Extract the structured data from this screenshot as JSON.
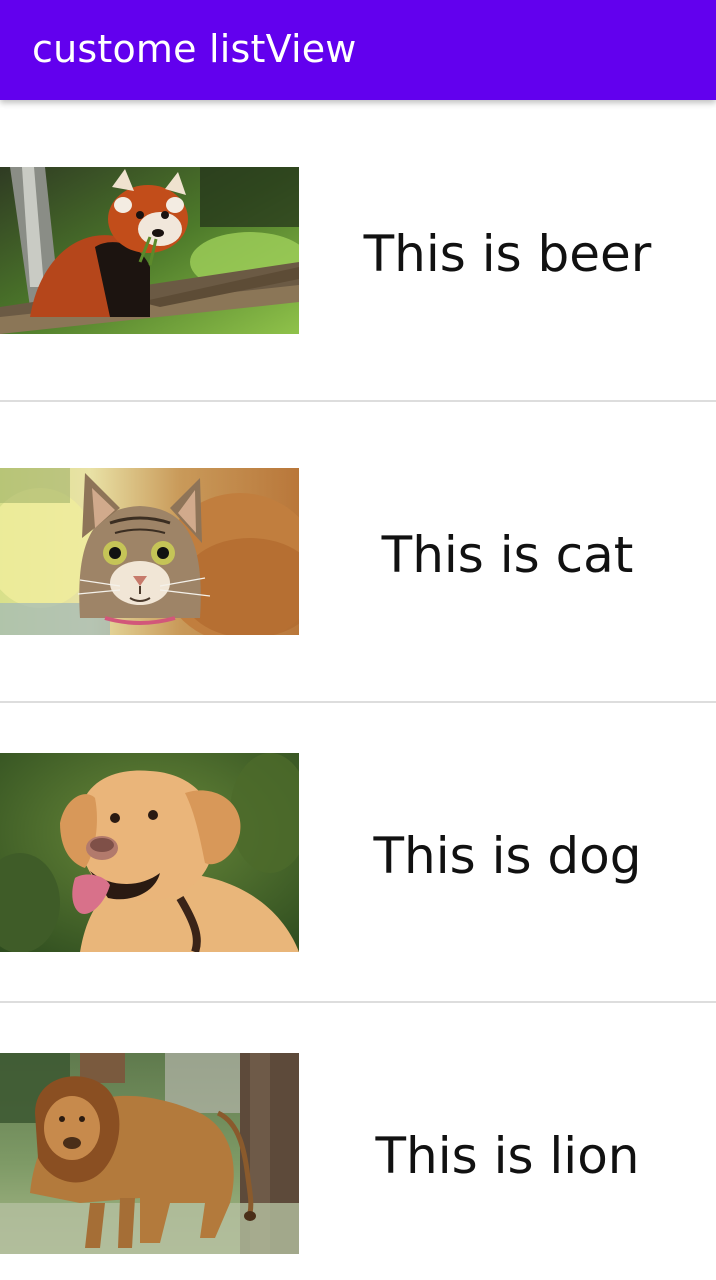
{
  "app_bar": {
    "title": "custome listView",
    "color": "#6200ee"
  },
  "list": {
    "items": [
      {
        "label": "This is beer",
        "image": "red-panda-photo"
      },
      {
        "label": "This is cat",
        "image": "tabby-cat-photo"
      },
      {
        "label": "This is dog",
        "image": "labrador-dog-photo"
      },
      {
        "label": "This is lion",
        "image": "lion-photo"
      }
    ]
  }
}
